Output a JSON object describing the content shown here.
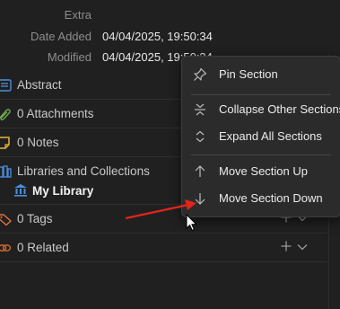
{
  "info": {
    "extra_label": "Extra",
    "date_added_label": "Date Added",
    "date_added_value": "04/04/2025, 19:50:34",
    "modified_label": "Modified",
    "modified_value": "04/04/2025, 19:50:34"
  },
  "sections": {
    "abstract": "Abstract",
    "attachments": "0 Attachments",
    "notes": "0 Notes",
    "libraries": "Libraries and Collections",
    "my_library": "My Library",
    "tags": "0 Tags",
    "related": "0 Related"
  },
  "context_menu": {
    "pin": "Pin Section",
    "collapse_other": "Collapse Other Sections",
    "expand_all": "Expand All Sections",
    "move_up": "Move Section Up",
    "move_down": "Move Section Down"
  },
  "colors": {
    "background": "#202020",
    "menu_background": "#2b2b2b",
    "section_icon_blue": "#4a8fe0",
    "attachments_green": "#6ea84c",
    "notes_yellow": "#e5b43c",
    "tags_orange": "#e0743c",
    "related_orange": "#d9682b",
    "annotation_arrow": "#e0251c"
  },
  "icons": {
    "abstract": "abstract-icon",
    "attachments": "paperclip-icon",
    "notes": "note-icon",
    "libraries": "libraries-icon",
    "my_library": "library-icon",
    "tags": "tag-icon",
    "related": "related-icon",
    "pin": "pin-icon",
    "collapse": "collapse-icon",
    "expand": "expand-icon",
    "move_up": "arrow-up-icon",
    "move_down": "arrow-down-icon",
    "add": "plus-icon",
    "toggle": "chevron-down-icon"
  }
}
